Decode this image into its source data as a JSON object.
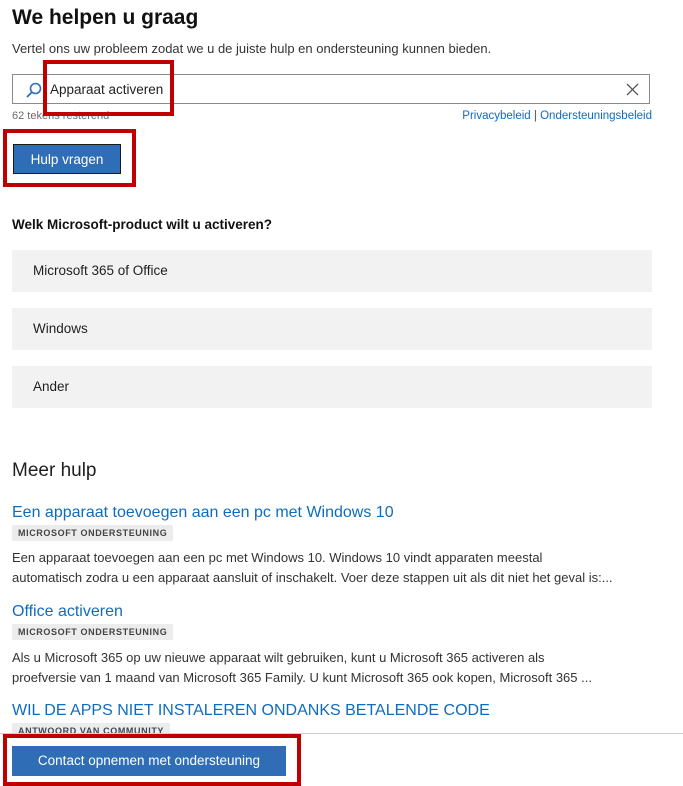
{
  "header": {
    "title": "We helpen u graag",
    "subtitle": "Vertel ons uw probleem zodat we u de juiste hulp en ondersteuning kunnen bieden."
  },
  "search": {
    "value": "Apparaat activeren",
    "chars_left": "62 tekens resterend",
    "icon": "search-icon",
    "clear_icon": "close-icon"
  },
  "links": {
    "privacy": "Privacybeleid",
    "separator": "|",
    "support_policy": "Ondersteuningsbeleid"
  },
  "help_button": {
    "label": "Hulp vragen"
  },
  "product_question": {
    "label": "Welk Microsoft-product wilt u activeren?",
    "options": [
      "Microsoft 365 of Office",
      "Windows",
      "Ander"
    ]
  },
  "more_help": {
    "title": "Meer hulp",
    "articles": [
      {
        "title": "Een apparaat toevoegen aan een pc met Windows 10",
        "badge": "MICROSOFT ONDERSTEUNING",
        "line1": "Een apparaat toevoegen aan een pc met Windows 10. Windows 10 vindt apparaten meestal",
        "line2": "automatisch zodra u een apparaat aansluit of inschakelt. Voer deze stappen uit als dit niet het geval is:..."
      },
      {
        "title": "Office activeren",
        "badge": "MICROSOFT ONDERSTEUNING",
        "line1": "Als u Microsoft 365 op uw nieuwe apparaat wilt gebruiken, kunt u Microsoft 365 activeren als",
        "line2": "proefversie van 1 maand van Microsoft 365 Family. U kunt Microsoft 365 ook kopen, Microsoft 365 ..."
      },
      {
        "title": "WIL DE APPS NIET INSTALEREN ONDANKS BETALENDE CODE",
        "badge": "ANTWOORD VAN COMMUNITY"
      }
    ]
  },
  "footer": {
    "contact_label": "Contact opnemen met ondersteuning"
  },
  "colors": {
    "accent": "#2f6eb6",
    "link": "#0f6cbd",
    "highlight": "#c00000",
    "option_bg": "#f2f2f2"
  }
}
